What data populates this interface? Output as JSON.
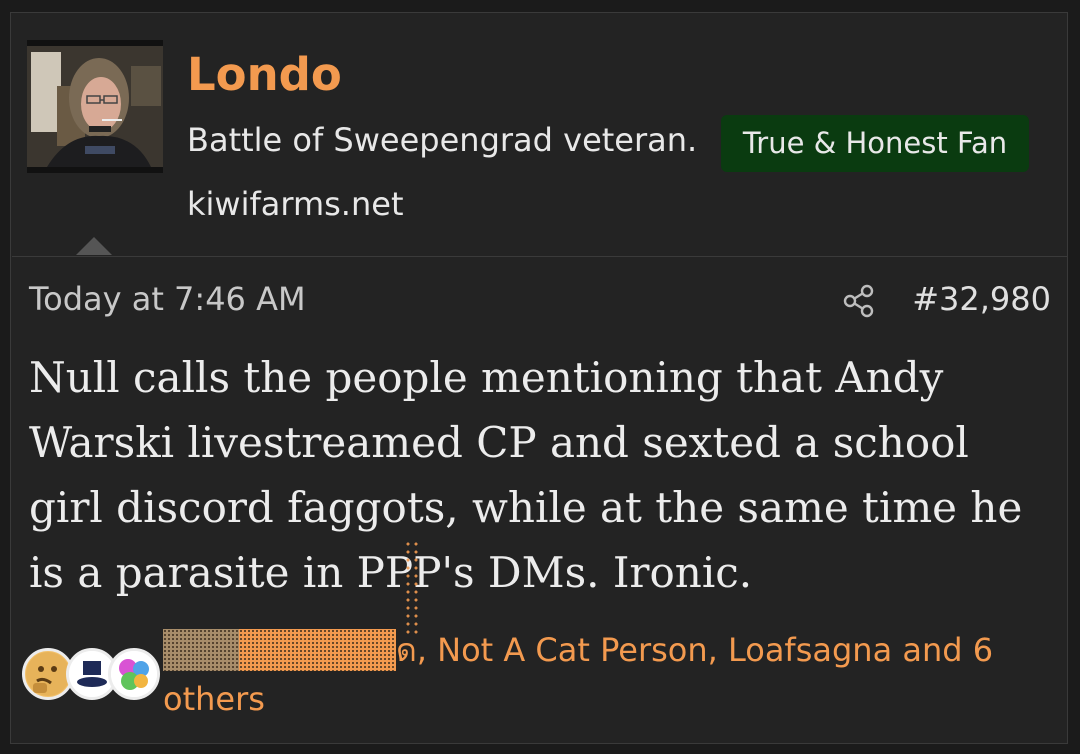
{
  "post": {
    "username": "Londo",
    "user_title": "Battle of Sweepengrad veteran.",
    "badge": "True & Honest Fan",
    "site": "kiwifarms.net",
    "timestamp": "Today at 7:46 AM",
    "post_number": "#32,980",
    "body": "Null calls the people mentioning that Andy Warski livestreamed CP and sexted a school girl discord faggots, while at the same time he is a parasite in PPP's DMs. Ironic."
  },
  "reactions": {
    "reactors_text": "ด, Not A Cat Person, Loafsagna and 6 others"
  },
  "icons": {
    "share": "share-icon"
  },
  "colors": {
    "accent": "#f39a4f",
    "badge_bg": "#0a3b10",
    "background": "#232323",
    "text": "#ececec"
  }
}
